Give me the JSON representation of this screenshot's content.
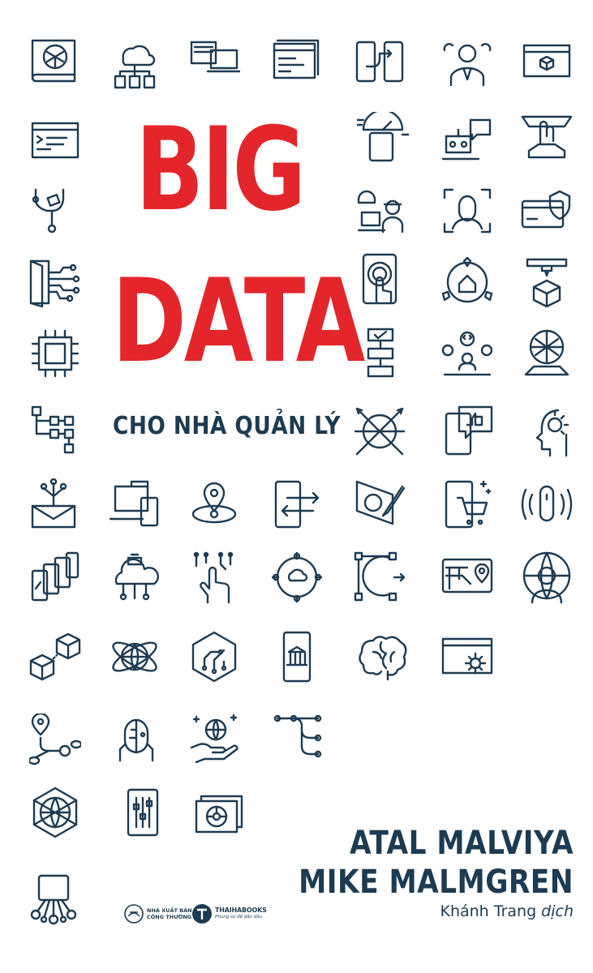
{
  "cover": {
    "title_line_1": "BIG",
    "title_line_2": "DATA",
    "subtitle": "CHO NHÀ QUẢN LÝ",
    "authors": [
      "ATAL MALVIYA",
      "MIKE MALMGREN"
    ],
    "translator_name": "Khánh Trang",
    "translator_role": "dịch",
    "colors": {
      "title": "#e3262b",
      "ink": "#1d3b52",
      "background": "#ffffff"
    }
  },
  "publishers": {
    "publisher_line_1": "NHÀ XUẤT BẢN",
    "publisher_line_2": "CÔNG THƯƠNG",
    "imprint_name": "THAIHABOOKS",
    "imprint_tagline": "Phụng sự để dẫn đầu"
  },
  "icons": [
    "brain-map-icon",
    "cloud-network-icon",
    "devices-icon",
    "code-windows-icon",
    "phone-transfer-icon",
    "team-chat-icon",
    "cube-window-icon",
    "terminal-icon",
    "phone-speed-icon",
    "robot-chat-icon",
    "vote-icon",
    "branch-icon",
    "worker-laptop-icon",
    "face-scan-icon",
    "secure-card-icon",
    "door-circuit-icon",
    "touch-phone-icon",
    "smart-home-icon",
    "3d-print-icon",
    "chip-icon",
    "flowchart-icon",
    "developer-icon",
    "ai-network-icon",
    "hierarchy-icon",
    "satellite-icon",
    "like-phone-icon",
    "ai-head-icon",
    "mail-network-icon",
    "laptop-phone-icon",
    "location-icon",
    "phone-swap-icon",
    "design-pen-icon",
    "shopping-phone-icon",
    "sensor-icon",
    "phone-stack-icon",
    "cloud-factory-icon",
    "hand-circuit-icon",
    "cloud-hub-icon",
    "vector-icon",
    "map-screen-icon",
    "global-person-icon",
    "cubes-icon",
    "orbit-globe-icon",
    "hexagon-circuit-icon",
    "bank-phone-icon",
    "brain-icon",
    "settings-window-icon",
    "route-icon",
    "cyborg-icon",
    "globe-hand-icon",
    "tree-nodes-icon",
    "network-globe-icon",
    "mixer-phone-icon",
    "camera-cards-icon",
    "tablet-nodes-icon"
  ]
}
